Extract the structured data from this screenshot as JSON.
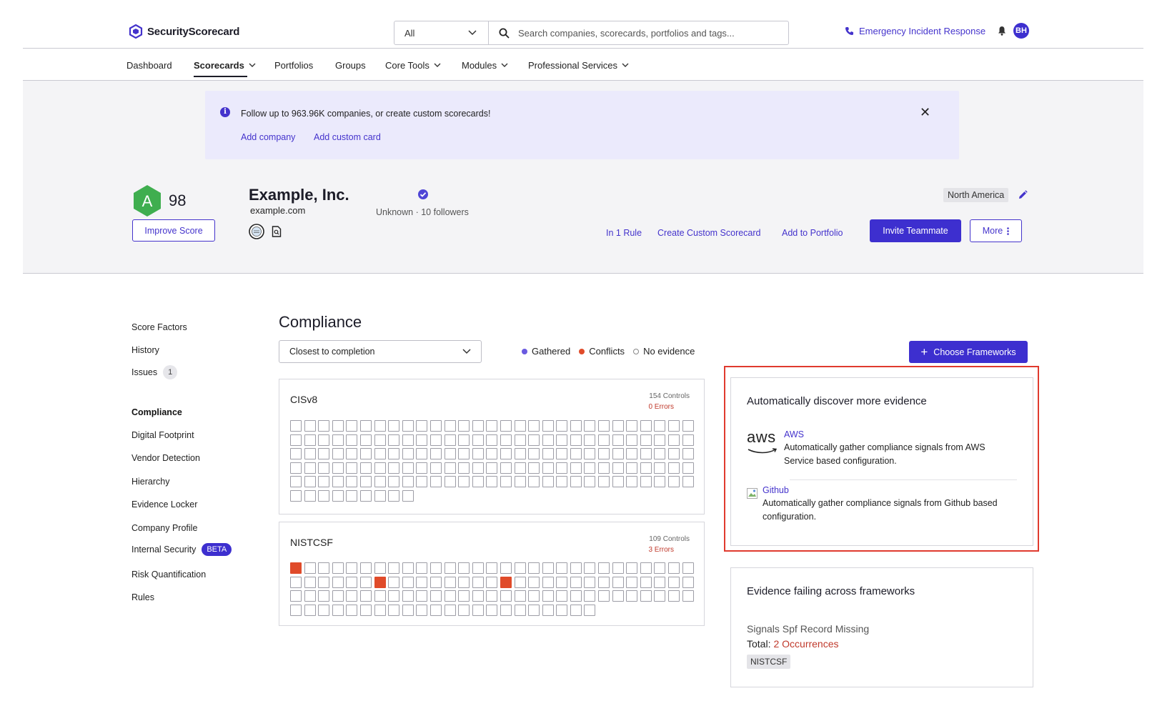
{
  "app": {
    "brand": "SecurityScorecard"
  },
  "search": {
    "scope": "All",
    "placeholder": "Search companies, scorecards, portfolios and tags..."
  },
  "header": {
    "emergency_label": "Emergency Incident Response",
    "avatar_initials": "BH"
  },
  "nav": {
    "items": [
      {
        "label": "Dashboard"
      },
      {
        "label": "Scorecards"
      },
      {
        "label": "Portfolios"
      },
      {
        "label": "Groups"
      },
      {
        "label": "Core Tools"
      },
      {
        "label": "Modules"
      },
      {
        "label": "Professional Services"
      }
    ]
  },
  "banner": {
    "message": "Follow up to 963.96K companies, or create custom scorecards!",
    "add_company": "Add company",
    "add_custom_card": "Add custom card"
  },
  "company": {
    "grade": "A",
    "score": "98",
    "name": "Example, Inc.",
    "domain": "example.com",
    "meta": "Unknown  ·  10 followers",
    "region": "North America",
    "improve_score": "Improve Score",
    "actions": {
      "rule": "In 1 Rule",
      "custom_scorecard": "Create Custom Scorecard",
      "add_portfolio": "Add to Portfolio",
      "invite": "Invite Teammate",
      "more": "More"
    }
  },
  "sidebar": {
    "items": [
      {
        "label": "Score Factors"
      },
      {
        "label": "History"
      },
      {
        "label": "Issues",
        "count": "1"
      },
      {
        "label": "Compliance"
      },
      {
        "label": "Digital Footprint"
      },
      {
        "label": "Vendor Detection"
      },
      {
        "label": "Hierarchy"
      },
      {
        "label": "Evidence Locker"
      },
      {
        "label": "Company Profile"
      },
      {
        "label": "Internal Security",
        "badge": "BETA"
      },
      {
        "label": "Risk Quantification"
      },
      {
        "label": "Rules"
      }
    ]
  },
  "compliance": {
    "title": "Compliance",
    "sort": "Closest to completion",
    "legend": {
      "gathered": "Gathered",
      "conflicts": "Conflicts",
      "no_evidence": "No evidence"
    },
    "choose_frameworks": "Choose Frameworks",
    "colors": {
      "gathered": "#6a5ae0",
      "conflict": "#e04b2a",
      "accent": "#3d2fcf"
    },
    "frameworks": [
      {
        "name": "CISv8",
        "controls_label": "154 Controls",
        "errors_label": "0 Errors",
        "controls": 154,
        "conflict_cells": []
      },
      {
        "name": "NISTCSF",
        "controls_label": "109 Controls",
        "errors_label": "3 Errors",
        "controls": 109,
        "conflict_cells": [
          0,
          35,
          44
        ]
      }
    ]
  },
  "discover": {
    "title": "Automatically discover more evidence",
    "aws": {
      "logo": "aws",
      "name": "AWS",
      "description": "Automatically gather compliance signals from AWS Service based configuration."
    },
    "github": {
      "name": "Github",
      "description": "Automatically gather compliance signals from Github based configuration."
    }
  },
  "failing": {
    "title": "Evidence failing across frameworks",
    "signal": "Signals Spf Record Missing",
    "total_label": "Total:",
    "occurrences": "2 Occurrences",
    "tag": "NISTCSF"
  }
}
